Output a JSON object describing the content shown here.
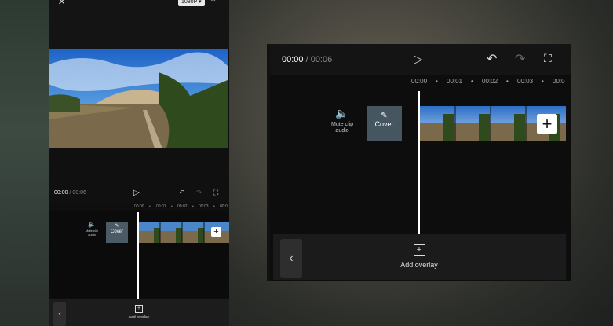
{
  "phone": {
    "resolution": "1080P ▾",
    "time_current": "00:00",
    "time_total": " / 00:06",
    "ruler": [
      "00:00",
      "•",
      "00:01",
      "•",
      "00:02",
      "•",
      "00:03",
      "•",
      "00:0"
    ],
    "mute_label": "Mute clip audio",
    "cover_label": "Cover",
    "add_overlay": "Add overlay"
  },
  "panel": {
    "time_current": "00:00",
    "time_total": " / 00:06",
    "ruler": [
      "00:00",
      "•",
      "00:01",
      "•",
      "00:02",
      "•",
      "00:03",
      "•",
      "00:0"
    ],
    "mute_label": "Mute clip audio",
    "cover_label": "Cover",
    "add_overlay": "Add overlay"
  },
  "icons": {
    "close": "×",
    "export": "⤒",
    "play": "▷",
    "undo": "↶",
    "redo": "↷",
    "fullscreen": "⛶",
    "speaker": "🔈",
    "pencil": "✎",
    "plus": "+",
    "back": "‹"
  }
}
